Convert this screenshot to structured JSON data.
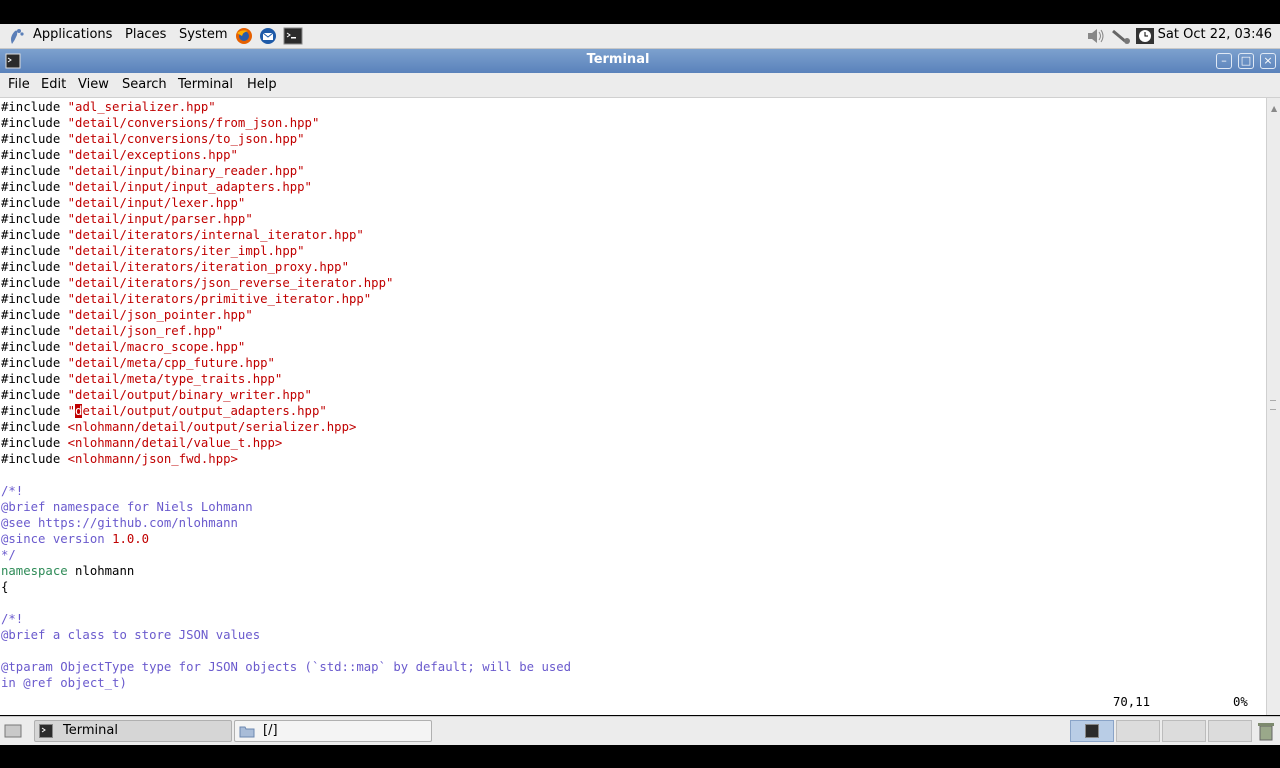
{
  "panel": {
    "applications": "Applications",
    "places": "Places",
    "system": "System",
    "clock": "Sat Oct 22, 03:46"
  },
  "window": {
    "title": "Terminal"
  },
  "menu": {
    "file": "File",
    "edit": "Edit",
    "view": "View",
    "search": "Search",
    "terminal": "Terminal",
    "help": "Help"
  },
  "lines": [
    {
      "kw": "#include ",
      "str": "\"adl_serializer.hpp\""
    },
    {
      "kw": "#include ",
      "str": "\"detail/conversions/from_json.hpp\""
    },
    {
      "kw": "#include ",
      "str": "\"detail/conversions/to_json.hpp\""
    },
    {
      "kw": "#include ",
      "str": "\"detail/exceptions.hpp\""
    },
    {
      "kw": "#include ",
      "str": "\"detail/input/binary_reader.hpp\""
    },
    {
      "kw": "#include ",
      "str": "\"detail/input/input_adapters.hpp\""
    },
    {
      "kw": "#include ",
      "str": "\"detail/input/lexer.hpp\""
    },
    {
      "kw": "#include ",
      "str": "\"detail/input/parser.hpp\""
    },
    {
      "kw": "#include ",
      "str": "\"detail/iterators/internal_iterator.hpp\""
    },
    {
      "kw": "#include ",
      "str": "\"detail/iterators/iter_impl.hpp\""
    },
    {
      "kw": "#include ",
      "str": "\"detail/iterators/iteration_proxy.hpp\""
    },
    {
      "kw": "#include ",
      "str": "\"detail/iterators/json_reverse_iterator.hpp\""
    },
    {
      "kw": "#include ",
      "str": "\"detail/iterators/primitive_iterator.hpp\""
    },
    {
      "kw": "#include ",
      "str": "\"detail/json_pointer.hpp\""
    },
    {
      "kw": "#include ",
      "str": "\"detail/json_ref.hpp\""
    },
    {
      "kw": "#include ",
      "str": "\"detail/macro_scope.hpp\""
    },
    {
      "kw": "#include ",
      "str": "\"detail/meta/cpp_future.hpp\""
    },
    {
      "kw": "#include ",
      "str": "\"detail/meta/type_traits.hpp\""
    },
    {
      "kw": "#include ",
      "str": "\"detail/output/binary_writer.hpp\""
    },
    {
      "kw": "#include ",
      "str": "\"",
      "cursor": "d",
      "str2": "etail/output/output_adapters.hpp\""
    },
    {
      "kw": "#include ",
      "str": "<nlohmann/detail/output/serializer.hpp>"
    },
    {
      "kw": "#include ",
      "str": "<nlohmann/detail/value_t.hpp>"
    },
    {
      "kw": "#include ",
      "str": "<nlohmann/json_fwd.hpp>"
    },
    {
      "kw": ""
    },
    {
      "cm": "/*!"
    },
    {
      "cm": "@brief namespace for Niels Lohmann"
    },
    {
      "cm": "@see https://github.com/nlohmann"
    },
    {
      "cm": "@since version ",
      "num": "1.0.0"
    },
    {
      "cm": "*/"
    },
    {
      "ns": "namespace",
      "kw": " nlohmann"
    },
    {
      "kw": "{"
    },
    {
      "kw": ""
    },
    {
      "cm": "/*!"
    },
    {
      "cm": "@brief a class to store JSON values"
    },
    {
      "kw": ""
    },
    {
      "cm": "@tparam ObjectType type for JSON objects (`std::map` by default; will be used"
    },
    {
      "cm": "in @ref object_t)"
    }
  ],
  "status": {
    "position": "70,11",
    "percent": "0%"
  },
  "taskbar": {
    "terminal": "Terminal",
    "folder": "[/]"
  }
}
